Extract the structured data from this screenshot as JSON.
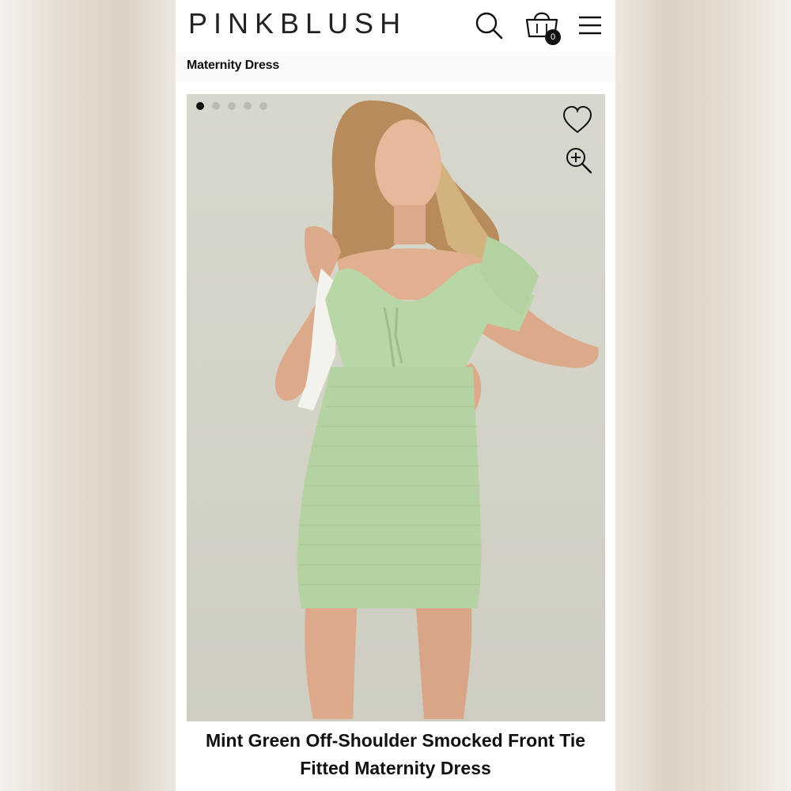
{
  "header": {
    "logo_text": "PINKBLUSH",
    "search_icon": "search-icon",
    "cart_icon": "shopping-bag-icon",
    "cart_count": "0",
    "menu_icon": "hamburger-menu-icon"
  },
  "breadcrumb": {
    "label": "Maternity Dress"
  },
  "gallery": {
    "dot_count": 5,
    "active_index": 0,
    "wishlist_icon": "heart-icon",
    "zoom_icon": "zoom-in-icon",
    "dress_color": "#b9d6a6"
  },
  "product": {
    "title_line1": "Mint Green Off-Shoulder Smocked Front Tie",
    "title_line2": "Fitted Maternity Dress"
  }
}
